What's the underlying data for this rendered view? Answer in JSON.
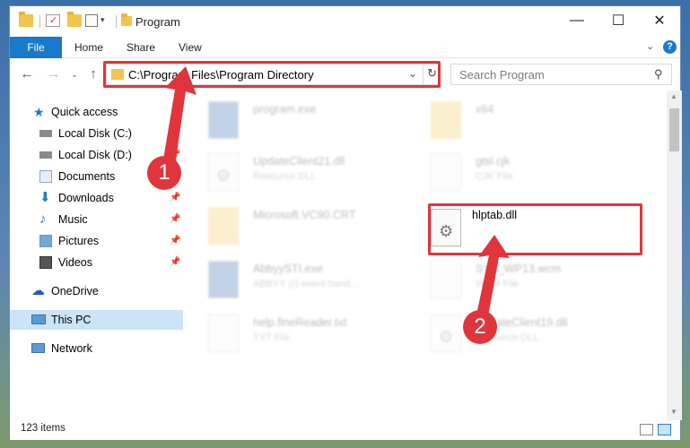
{
  "window": {
    "title": "Program"
  },
  "ribbon": {
    "tabs": [
      "File",
      "Home",
      "Share",
      "View"
    ]
  },
  "address": {
    "path": "C:\\Program Files\\Program Directory"
  },
  "search": {
    "placeholder": "Search Program"
  },
  "nav": {
    "items": [
      {
        "label": "Quick access",
        "icon": "star-icon",
        "pinned": false
      },
      {
        "label": "Local Disk (C:)",
        "icon": "drive-icon",
        "pinned": false
      },
      {
        "label": "Local Disk (D:)",
        "icon": "drive-icon",
        "pinned": true
      },
      {
        "label": "Documents",
        "icon": "documents-icon",
        "pinned": false
      },
      {
        "label": "Downloads",
        "icon": "download-icon",
        "pinned": true
      },
      {
        "label": "Music",
        "icon": "music-icon",
        "pinned": true
      },
      {
        "label": "Pictures",
        "icon": "pictures-icon",
        "pinned": true
      },
      {
        "label": "Videos",
        "icon": "videos-icon",
        "pinned": true
      },
      {
        "label": "OneDrive",
        "icon": "cloud-icon",
        "pinned": false
      },
      {
        "label": "This PC",
        "icon": "computer-icon",
        "pinned": false
      },
      {
        "label": "Network",
        "icon": "network-icon",
        "pinned": false
      }
    ]
  },
  "files": [
    {
      "name": "program.exe",
      "type": "",
      "icon": "exe-icon"
    },
    {
      "name": "x64",
      "type": "",
      "icon": "folder-icon"
    },
    {
      "name": "UpdateClient21.dll",
      "type": "Resource DLL",
      "icon": "dll-icon"
    },
    {
      "name": "gtsl.cjk",
      "type": "CJK File",
      "icon": "file-icon"
    },
    {
      "name": "Microsoft.VC90.CRT",
      "type": "",
      "icon": "folder-icon"
    },
    {
      "name": "hlptab.dll",
      "type": "",
      "icon": "dll-icon"
    },
    {
      "name": "AbbyySTI.exe",
      "type": "ABBYY (r) event hand...",
      "icon": "exe-icon"
    },
    {
      "name": "SYS_WP13.wcm",
      "type": "WCM File",
      "icon": "file-icon"
    },
    {
      "name": "help.fineReader.txt",
      "type": "TXT File",
      "icon": "text-icon"
    },
    {
      "name": "UpdateClient19.dll",
      "type": "Resource DLL",
      "icon": "dll-icon"
    }
  ],
  "status": {
    "items_count": "123 items"
  },
  "callouts": [
    "1",
    "2"
  ],
  "colors": {
    "accent": "#1979ca",
    "highlight": "#e0353c"
  }
}
